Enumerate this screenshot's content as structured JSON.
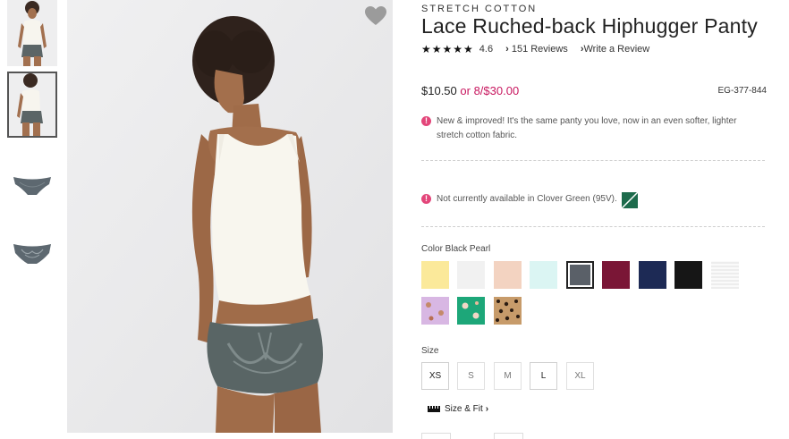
{
  "product": {
    "brand": "STRETCH COTTON",
    "title": "Lace Ruched-back Hiphugger Panty",
    "rating": "4.6",
    "stars": "★★★★★",
    "reviews_link": "151 Reviews",
    "write_review_link": "Write a Review",
    "price": "$10.50",
    "price_or": "or",
    "price_offer": "8/$30.00",
    "sku": "EG-377-844",
    "notice_new": "New & improved! It's the same panty you love, now in an even softer, lighter stretch cotton fabric.",
    "notice_unavailable": "Not currently available in Clover Green (95V).",
    "color_label": "Color Black Pearl",
    "size_label": "Size",
    "size_fit_link": "Size & Fit",
    "sizes": [
      "XS",
      "S",
      "M",
      "L",
      "XL"
    ]
  },
  "colors": {
    "accent": "#c8175f",
    "alert": "#e3467a",
    "swatches": [
      "#fbe99a",
      "#f1f1f1",
      "#f3d3c1",
      "#dbf5f3",
      "#5a6068",
      "#7a1636",
      "#1d2a55",
      "#161616",
      "#efefef",
      "#d8b7e3",
      "#1da779",
      "#c79b6a"
    ]
  },
  "icons": {
    "heart": "heart-icon",
    "alert": "alert-circle-icon",
    "ruler": "ruler-icon",
    "chevron": "chevron-right-icon"
  }
}
